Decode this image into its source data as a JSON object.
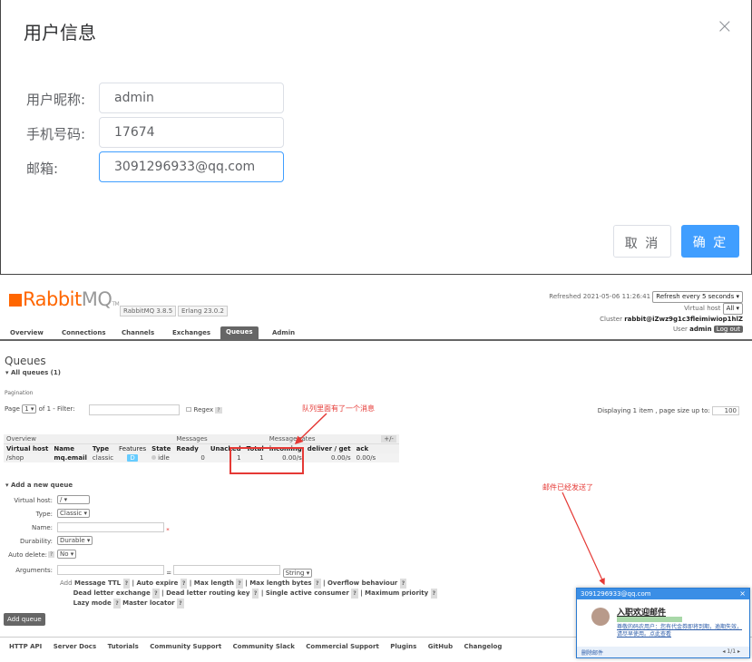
{
  "dialog": {
    "title": "用户信息",
    "close_icon": "×",
    "fields": [
      {
        "label": "用户昵称:",
        "value": "admin"
      },
      {
        "label": "手机号码:",
        "value": "17674"
      },
      {
        "label": "邮箱:",
        "value": "3091296933@qq.com"
      }
    ],
    "cancel_label": "取 消",
    "ok_label": "确 定",
    "colors": {
      "primary": "#409eff"
    }
  },
  "rabbitmq": {
    "logo_rabbit": "Rabbit",
    "logo_mq": "MQ",
    "logo_tm": "TM",
    "version": "RabbitMQ 3.8.5",
    "erlang": "Erlang 23.0.2",
    "refreshed": "Refreshed 2021-05-06 11:26:41",
    "refresh_select": "Refresh every 5 seconds",
    "vhost_label": "Virtual host",
    "vhost_select": "All",
    "cluster_label": "Cluster",
    "cluster_value": "rabbit@iZwz9g1c3fleimiwiop1hlZ",
    "user_label": "User",
    "user_value": "admin",
    "logout": "Log out",
    "tabs": [
      "Overview",
      "Connections",
      "Channels",
      "Exchanges",
      "Queues",
      "Admin"
    ],
    "active_tab": "Queues",
    "heading": "Queues",
    "all_queues": "All queues (1)",
    "pagination": "Pagination",
    "page_label": "Page",
    "page_value": "1",
    "of_label": "of 1  - Filter:",
    "regex_label": "Regex",
    "help": "?",
    "displaying": "Displaying 1 item , page size up to:",
    "page_size": "100",
    "table": {
      "groups": [
        "Overview",
        "Messages",
        "Message rates"
      ],
      "plusminus": "+/-",
      "headers": [
        "Virtual host",
        "Name",
        "Type",
        "Features",
        "State",
        "Ready",
        "Unacked",
        "Total",
        "incoming",
        "deliver / get",
        "ack"
      ],
      "row": {
        "vhost": "/shop",
        "name": "mq.email",
        "type": "classic",
        "features": "D",
        "state": "idle",
        "ready": "0",
        "unacked": "1",
        "total": "1",
        "incoming": "0.00/s",
        "deliver_get": "0.00/s",
        "ack": "0.00/s"
      }
    },
    "annotation_queue": "队列里面有了一个消息",
    "annotation_mail": "邮件已经发送了",
    "add_queue": {
      "heading": "Add a new queue",
      "virtual_host_label": "Virtual host:",
      "virtual_host_value": "/",
      "type_label": "Type:",
      "type_value": "Classic",
      "name_label": "Name:",
      "required": "*",
      "durability_label": "Durability:",
      "durability_value": "Durable",
      "auto_delete_label": "Auto delete:",
      "auto_delete_value": "No",
      "arguments_label": "Arguments:",
      "equals": "=",
      "arg_type": "String",
      "add_label": "Add",
      "arg_links": [
        "Message TTL",
        "Auto expire",
        "Max length",
        "Max length bytes",
        "Overflow behaviour",
        "Dead letter exchange",
        "Dead letter routing key",
        "Single active consumer",
        "Maximum priority",
        "Lazy mode",
        "Master locator"
      ],
      "button": "Add queue"
    },
    "footer": [
      "HTTP API",
      "Server Docs",
      "Tutorials",
      "Community Support",
      "Community Slack",
      "Commercial Support",
      "Plugins",
      "GitHub",
      "Changelog"
    ]
  },
  "mail_popup": {
    "account": "3091296933@qq.com",
    "close": "×",
    "subject": "入职欢迎邮件",
    "body": "尊敬的码农用户：您有代金券即将到期，逾期失效，请尽早使用。点此查看",
    "delete": "删除邮件",
    "nav": "◂ 1/1 ▸"
  }
}
